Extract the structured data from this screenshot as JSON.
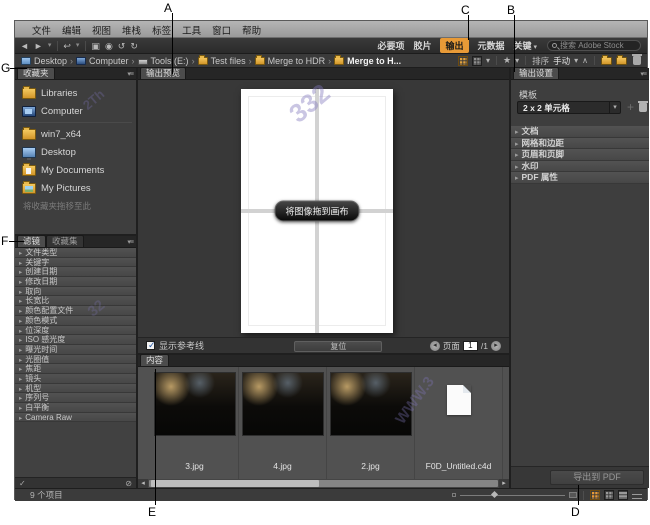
{
  "callouts": {
    "a": "A",
    "b": "B",
    "c": "C",
    "d": "D",
    "e": "E",
    "f": "F",
    "g": "G"
  },
  "menu_bar": {
    "items": [
      "文件",
      "编辑",
      "视图",
      "堆栈",
      "标签",
      "工具",
      "窗口",
      "帮助"
    ]
  },
  "toolbar": {
    "workspaces": [
      {
        "label": "必要项"
      },
      {
        "label": "胶片"
      },
      {
        "label": "输出",
        "active": true
      },
      {
        "label": "元数据"
      },
      {
        "label": "关键",
        "caret": true
      }
    ],
    "search_placeholder": "搜索 Adobe Stock"
  },
  "path_bar": {
    "crumbs": [
      {
        "label": "Desktop",
        "icon": "monitor"
      },
      {
        "label": "Computer",
        "icon": "computer"
      },
      {
        "label": "Tools (E:)",
        "icon": "drive"
      },
      {
        "label": "Test files",
        "icon": "folder"
      },
      {
        "label": "Merge to HDR",
        "icon": "folder"
      },
      {
        "label": "Merge to H...",
        "icon": "folder",
        "bold": true
      }
    ],
    "sort_label": "排序",
    "sort_value": "手动"
  },
  "favorites": {
    "tab": "收藏夹",
    "items": [
      {
        "label": "Libraries",
        "icon": "folder"
      },
      {
        "label": "Computer",
        "icon": "computer"
      },
      {
        "label": "win7_x64",
        "icon": "folder"
      },
      {
        "label": "Desktop",
        "icon": "desktop"
      },
      {
        "label": "My Documents",
        "icon": "docs"
      },
      {
        "label": "My Pictures",
        "icon": "pics"
      }
    ],
    "hint": "将收藏夹拖移至此"
  },
  "filter": {
    "tabs": {
      "filter": "滤镜",
      "collections": "收藏集"
    },
    "rows": [
      "文件类型",
      "关键字",
      "创建日期",
      "修改日期",
      "取向",
      "长宽比",
      "颜色配置文件",
      "颜色模式",
      "位深度",
      "ISO 感光度",
      "曝光时间",
      "光圈值",
      "焦距",
      "镜头",
      "机型",
      "序列号",
      "白平衡",
      "Camera Raw"
    ]
  },
  "preview": {
    "tab": "输出预览",
    "drop_hint": "将图像拖到画布",
    "show_guides": "显示参考线",
    "reset": "复位",
    "page_label": "页面",
    "page_value": "1",
    "page_total": "/1"
  },
  "content": {
    "tab": "内容",
    "items": [
      {
        "name": "3.jpg",
        "kind": "photo"
      },
      {
        "name": "4.jpg",
        "kind": "photo"
      },
      {
        "name": "2.jpg",
        "kind": "photo"
      },
      {
        "name": "F0D_Untitled.c4d",
        "kind": "doc"
      }
    ]
  },
  "output": {
    "tab": "输出设置",
    "template_label": "模板",
    "template_value": "2 x 2 单元格",
    "sections": [
      "文档",
      "网格和边距",
      "页眉和页脚",
      "水印",
      "PDF 属性"
    ],
    "export_button": "导出到 PDF"
  },
  "status_bar": {
    "items_count": "9 个项目"
  },
  "watermark": {
    "f1": "332",
    "f2": "WWW.3",
    "f3": "2Th",
    "f4": "32"
  },
  "colors": {
    "accent": "#e89a37",
    "panel": "#3e3e3e",
    "canvas": "#383838"
  },
  "icons": {
    "back": "◄",
    "forward": "►",
    "caret": "▾",
    "boomerang": "↩",
    "camera": "▣",
    "refine": "◉",
    "rotate_left": "↺",
    "rotate_right": "↻",
    "star": "★",
    "up": "∧",
    "prev": "◂",
    "next": "▸",
    "check": "✓",
    "pin": "✓",
    "clear": "⊘",
    "panelmenu": "▾≡"
  }
}
